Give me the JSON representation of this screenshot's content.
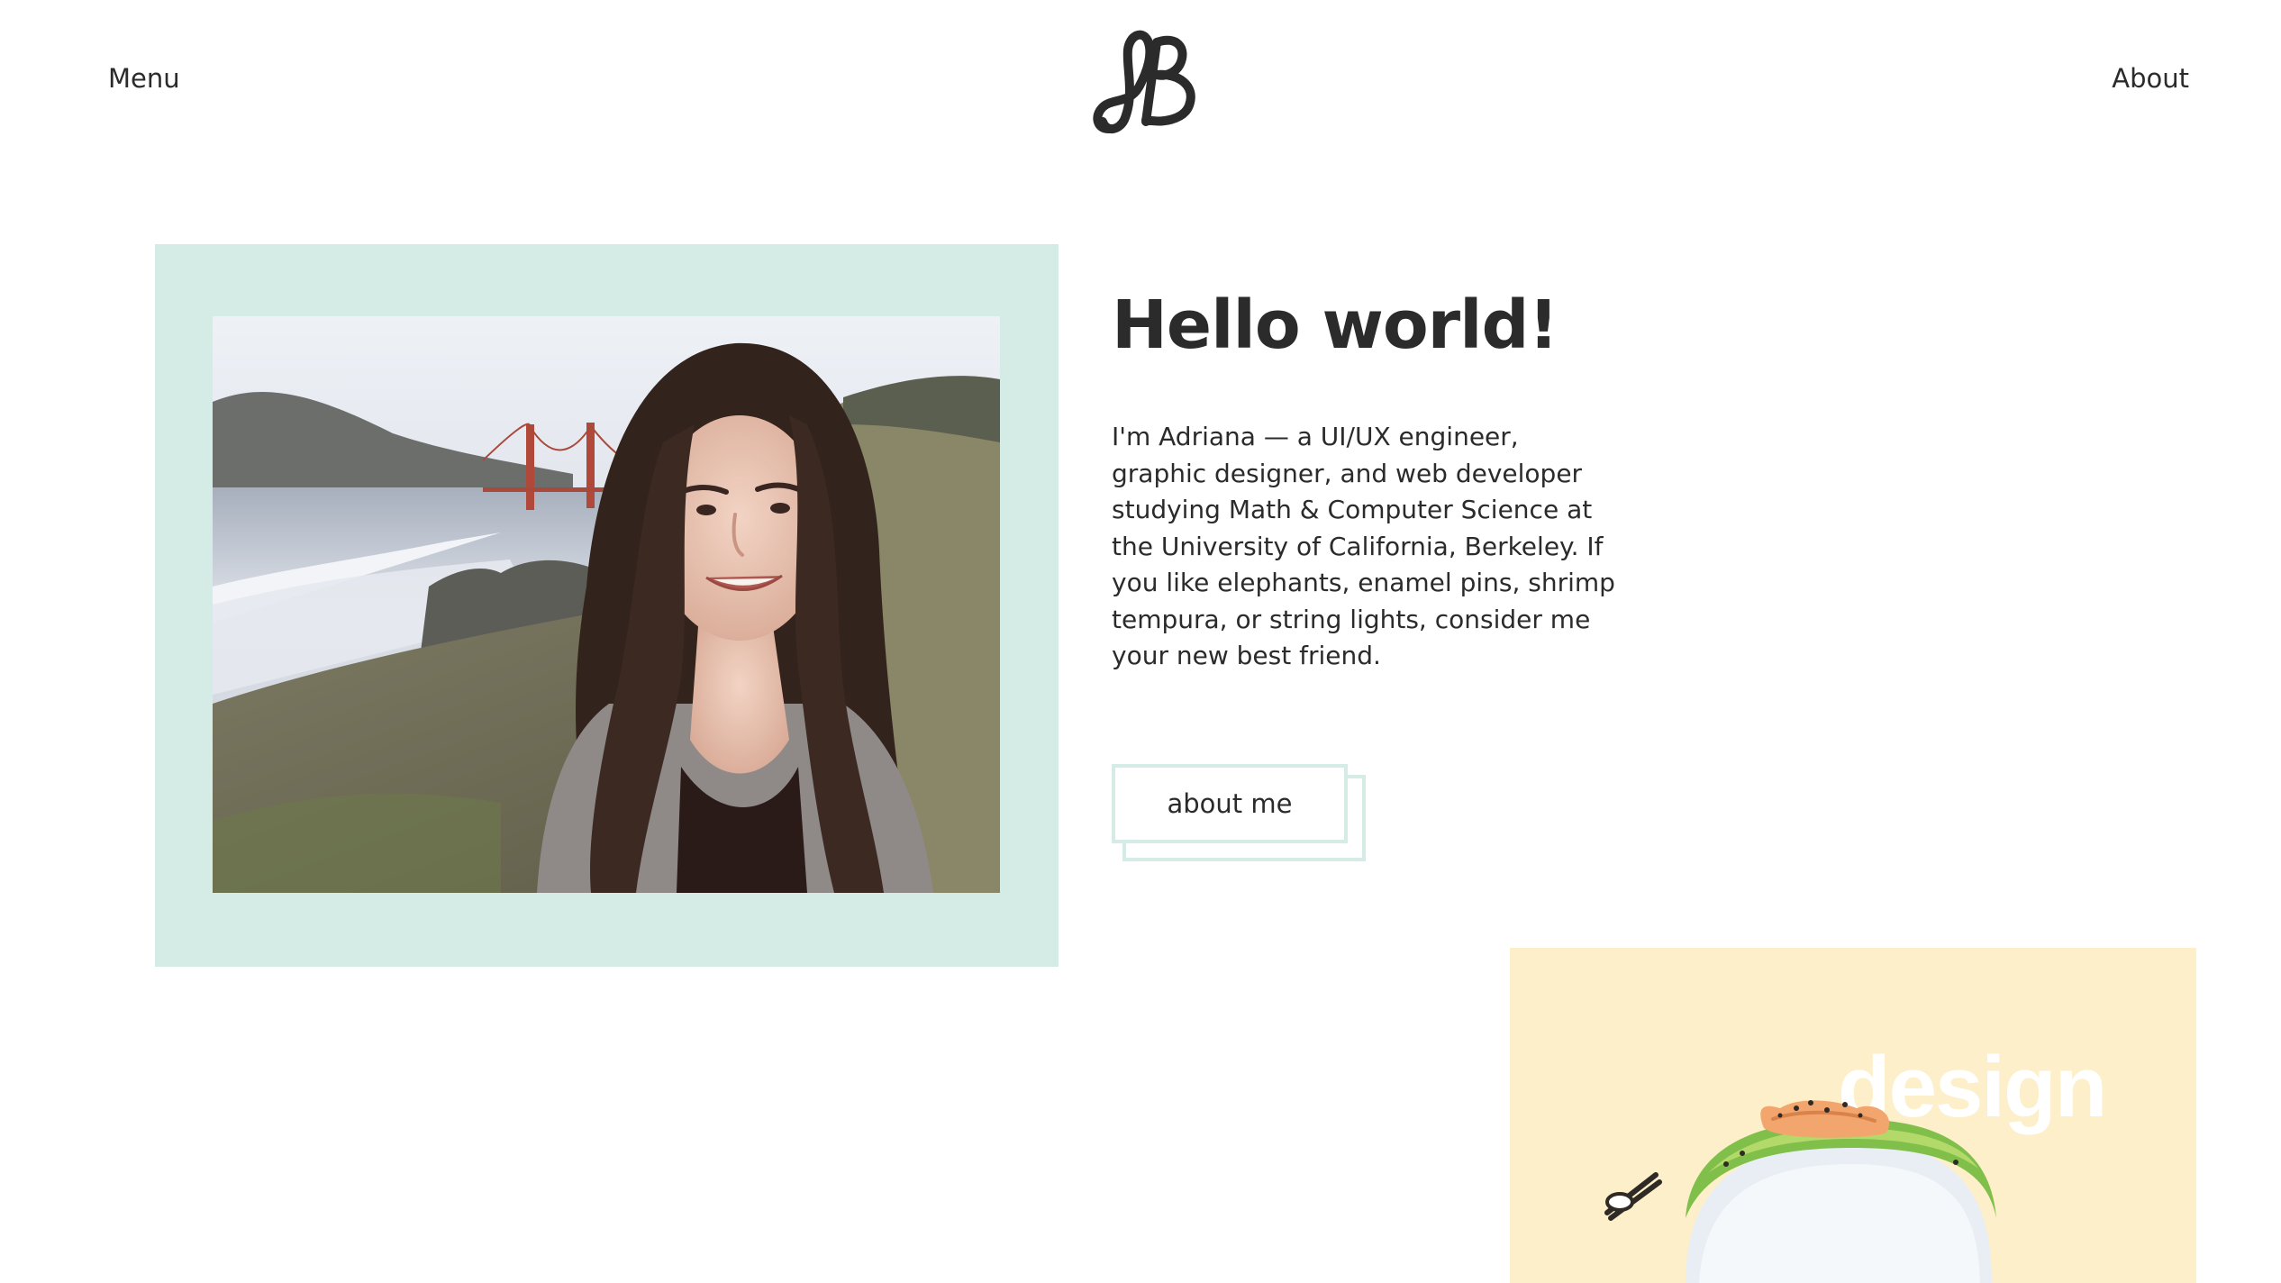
{
  "header": {
    "menu_label": "Menu",
    "about_label": "About",
    "logo_icon": "ab-monogram-logo"
  },
  "hero": {
    "title": "Hello world!",
    "intro": "I'm Adriana — a UI/UX engineer, graphic designer, and web developer studying Math & Computer Science at the University of California, Berkeley. If you like elephants, enamel pins, shrimp tempura, or string lights, consider me your new best friend.",
    "button_label": "about me"
  },
  "project_card": {
    "label": "design",
    "icon": "chopsticks-icon"
  },
  "colors": {
    "accent_mint": "#d4ebe6",
    "card_cream": "#fdefc9",
    "text": "#2b2b2b"
  }
}
